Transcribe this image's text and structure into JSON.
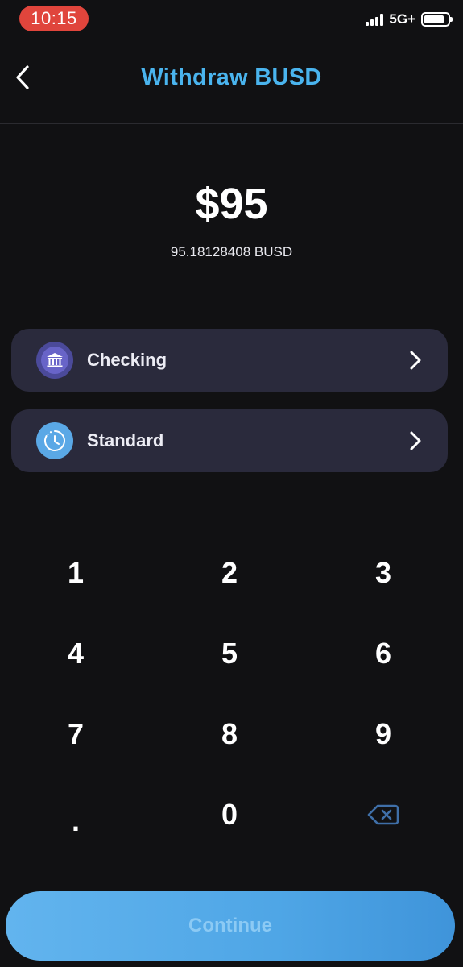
{
  "status_bar": {
    "time": "10:15",
    "network": "5G+",
    "battery_level": 0.85
  },
  "header": {
    "title": "Withdraw BUSD",
    "back_icon": "chevron-left-icon"
  },
  "amount": {
    "fiat": "$95",
    "crypto": "95.18128408 BUSD"
  },
  "options": [
    {
      "label": "Checking",
      "icon": "bank-icon"
    },
    {
      "label": "Standard",
      "icon": "clock-icon"
    }
  ],
  "keypad": {
    "keys": [
      "1",
      "2",
      "3",
      "4",
      "5",
      "6",
      "7",
      "8",
      "9",
      ".",
      "0"
    ],
    "backspace_icon": "backspace-icon"
  },
  "continue_label": "Continue",
  "colors": {
    "accent": "#4ab4ee",
    "background": "#111113",
    "card": "#2a2a3c",
    "status_pill": "#e0453c"
  }
}
